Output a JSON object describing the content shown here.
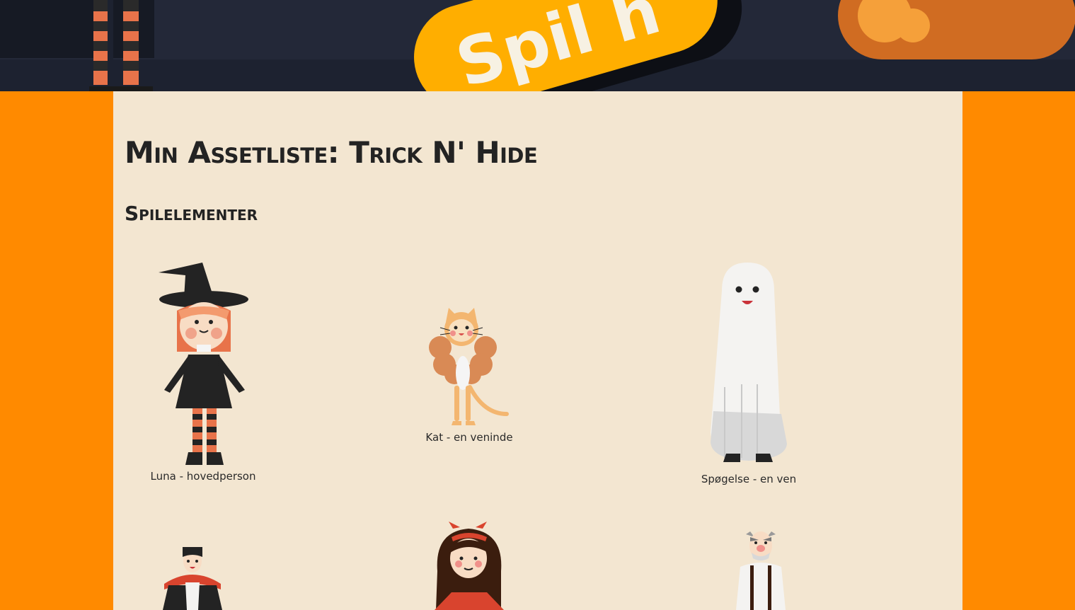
{
  "header": {
    "play_button_label": "Spil h"
  },
  "page": {
    "title": "Min assetliste: Trick n' Hide",
    "section_title": "Spilelementer"
  },
  "characters": [
    {
      "caption": "Luna - hovedperson",
      "icon": "witch-icon"
    },
    {
      "caption": "Kat - en veninde",
      "icon": "cat-icon"
    },
    {
      "caption": "Spøgelse - en ven",
      "icon": "ghost-icon"
    },
    {
      "caption": "",
      "icon": "vampire-icon"
    },
    {
      "caption": "",
      "icon": "devil-girl-icon"
    },
    {
      "caption": "",
      "icon": "old-man-icon"
    }
  ],
  "colors": {
    "background": "#ff8a00",
    "header": "#232838",
    "content": "#f3e6d1",
    "accent_yellow": "#ffae00",
    "pumpkin": "#d97424"
  }
}
